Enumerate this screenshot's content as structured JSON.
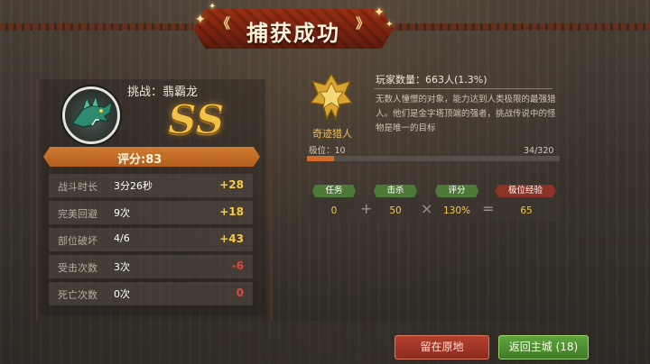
{
  "banner": {
    "title": "捕获成功",
    "left_deco": "《",
    "right_deco": "》"
  },
  "monster": {
    "challenge_label": "挑战：翡霸龙",
    "grade": "SS"
  },
  "score": {
    "label": "评分:83"
  },
  "stats": [
    {
      "label": "战斗时长",
      "value": "3分26秒",
      "bonus": "+28",
      "tone": "yellow"
    },
    {
      "label": "完美回避",
      "value": "9次",
      "bonus": "+18",
      "tone": "yellow"
    },
    {
      "label": "部位破坏",
      "value": "4/6",
      "bonus": "+43",
      "tone": "yellow"
    },
    {
      "label": "受击次数",
      "value": "3次",
      "bonus": "-6",
      "tone": "red"
    },
    {
      "label": "死亡次数",
      "value": "0次",
      "bonus": "0",
      "tone": "red"
    }
  ],
  "achievement": {
    "badge_label": "奇迹猎人",
    "players": "玩家数量：663人(1.3%)",
    "description": "无数人憧憬的对象，能力达到人类极限的最强猎人。他们是金字塔顶端的强者，挑战传说中的怪物是唯一的目标",
    "rank_label": "极位：10",
    "rank_progress": "34/320",
    "rank_fraction": 0.106
  },
  "exp": {
    "headers": [
      "任务",
      "击杀",
      "评分",
      "极位经验"
    ],
    "values": [
      "0",
      "50",
      "130%",
      "65"
    ],
    "ops": [
      "+",
      "×",
      "="
    ]
  },
  "buttons": {
    "stay": "留在原地",
    "return": "返回主城 (18)"
  },
  "colors": {
    "accent_orange": "#c96a26",
    "bonus_yellow": "#f7c947",
    "bonus_red": "#e0473a",
    "stay_red": "#9a3326",
    "return_green": "#4f8f31"
  }
}
